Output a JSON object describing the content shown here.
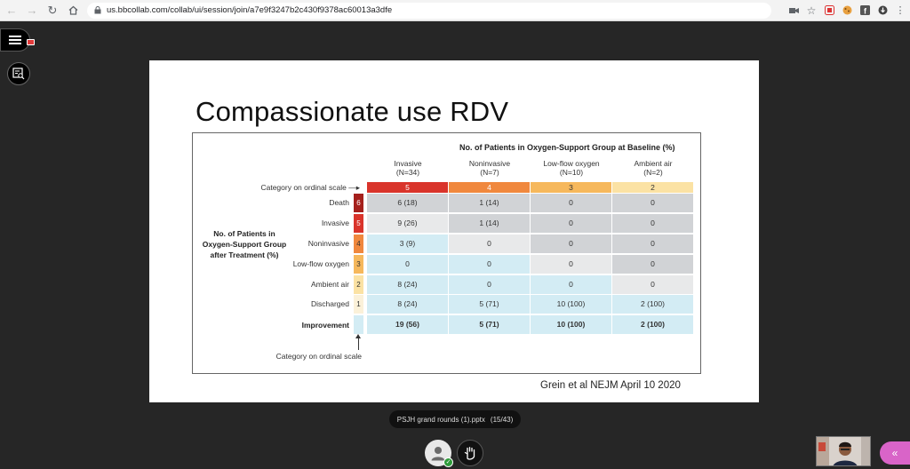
{
  "browser": {
    "url": "us.bbcollab.com/collab/ui/session/join/a7e9f3247b2c430f9378ac60013a3dfe"
  },
  "slide": {
    "title": "Compassionate use RDV",
    "citation": "Grein et al NEJM April 10 2020"
  },
  "figure": {
    "header": "No. of Patients in Oxygen-Support Group at Baseline (%)",
    "columns": [
      {
        "name": "Invasive",
        "n": "(N=34)",
        "scale": "5",
        "color": "#d9342b",
        "text_color": "#ffffff"
      },
      {
        "name": "Noninvasive",
        "n": "(N=7)",
        "scale": "4",
        "color": "#f0883e",
        "text_color": "#ffffff"
      },
      {
        "name": "Low-flow oxygen",
        "n": "(N=10)",
        "scale": "3",
        "color": "#f6b85c",
        "text_color": "#333333"
      },
      {
        "name": "Ambient air",
        "n": "(N=2)",
        "scale": "2",
        "color": "#fbe2a4",
        "text_color": "#333333"
      }
    ],
    "scale_label": "Category on ordinal scale",
    "group_label": "No. of Patients in Oxygen-Support Group after Treatment (%)",
    "rows": [
      {
        "label": "Death",
        "cat": "6",
        "cat_color": "#a5201c",
        "cells": [
          "6 (18)",
          "1 (14)",
          "0",
          "0"
        ],
        "shades": [
          "g",
          "g",
          "g",
          "g"
        ]
      },
      {
        "label": "Invasive",
        "cat": "5",
        "cat_color": "#d9342b",
        "cells": [
          "9 (26)",
          "1 (14)",
          "0",
          "0"
        ],
        "shades": [
          "l",
          "g",
          "g",
          "g"
        ]
      },
      {
        "label": "Noninvasive",
        "cat": "4",
        "cat_color": "#f0883e",
        "cells": [
          "3 (9)",
          "0",
          "0",
          "0"
        ],
        "shades": [
          "b",
          "l",
          "g",
          "g"
        ]
      },
      {
        "label": "Low-flow oxygen",
        "cat": "3",
        "cat_color": "#f6b85c",
        "cells": [
          "0",
          "0",
          "0",
          "0"
        ],
        "shades": [
          "b",
          "b",
          "l",
          "g"
        ]
      },
      {
        "label": "Ambient air",
        "cat": "2",
        "cat_color": "#fbe2a4",
        "cells": [
          "8 (24)",
          "0",
          "0",
          "0"
        ],
        "shades": [
          "b",
          "b",
          "b",
          "l"
        ]
      },
      {
        "label": "Discharged",
        "cat": "1",
        "cat_color": "#fbf1d9",
        "cells": [
          "8 (24)",
          "5 (71)",
          "10 (100)",
          "2 (100)"
        ],
        "shades": [
          "b",
          "b",
          "b",
          "b"
        ]
      }
    ],
    "improvement": {
      "label": "Improvement",
      "cells": [
        "19 (56)",
        "5 (71)",
        "10 (100)",
        "2 (100)"
      ]
    },
    "footer_label": "Category on ordinal scale",
    "shade_colors": {
      "g": "#d1d3d6",
      "l": "#e8e9ea",
      "b": "#d3ecf4"
    }
  },
  "collab": {
    "file_name": "PSJH grand rounds (1).pptx",
    "page_indicator": "(15/43)"
  }
}
